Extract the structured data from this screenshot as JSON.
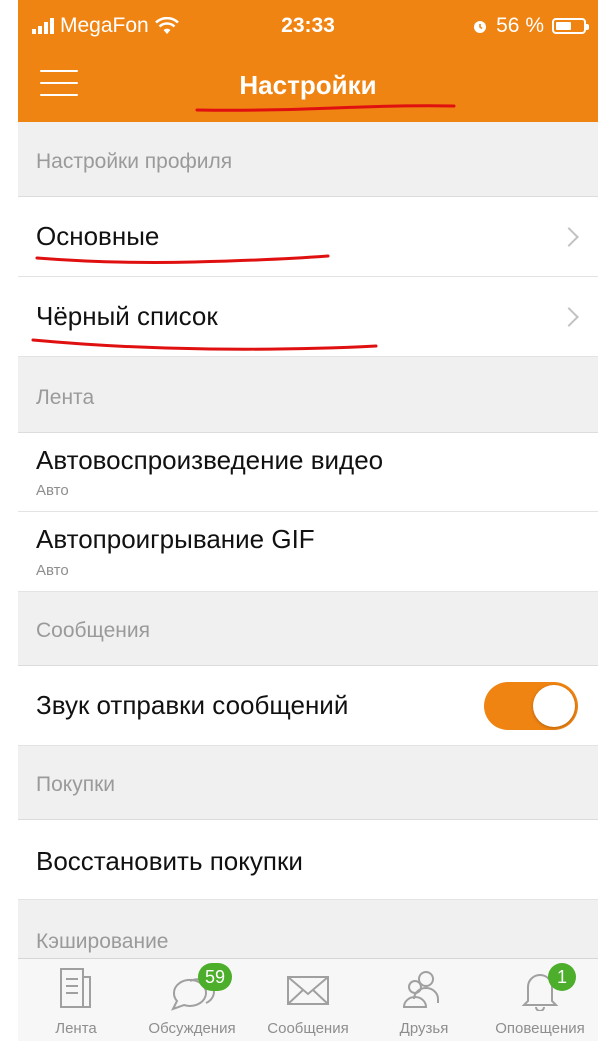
{
  "status_bar": {
    "carrier": "MegaFon",
    "time": "23:33",
    "battery_percent": "56 %",
    "battery_level": 0.56
  },
  "header": {
    "title": "Настройки"
  },
  "sections": {
    "profile": "Настройки профиля",
    "feed": "Лента",
    "messages": "Сообщения",
    "purchases": "Покупки",
    "cache": "Кэширование"
  },
  "rows": {
    "general": "Основные",
    "blacklist": "Чёрный список",
    "video_autoplay": {
      "label": "Автовоспроизведение видео",
      "value": "Авто"
    },
    "gif_autoplay": {
      "label": "Автопроигрывание GIF",
      "value": "Авто"
    },
    "send_sound": {
      "label": "Звук отправки сообщений",
      "enabled": true
    },
    "restore_purchases": "Восстановить покупки"
  },
  "tabs": [
    {
      "label": "Лента",
      "icon": "feed-icon"
    },
    {
      "label": "Обсуждения",
      "icon": "discussions-icon",
      "badge": "59"
    },
    {
      "label": "Сообщения",
      "icon": "envelope-icon"
    },
    {
      "label": "Друзья",
      "icon": "friends-icon"
    },
    {
      "label": "Оповещения",
      "icon": "bell-icon",
      "badge": "1"
    }
  ],
  "colors": {
    "accent": "#ef8412",
    "badge": "#4cae2b",
    "annotation": "#e01010"
  }
}
